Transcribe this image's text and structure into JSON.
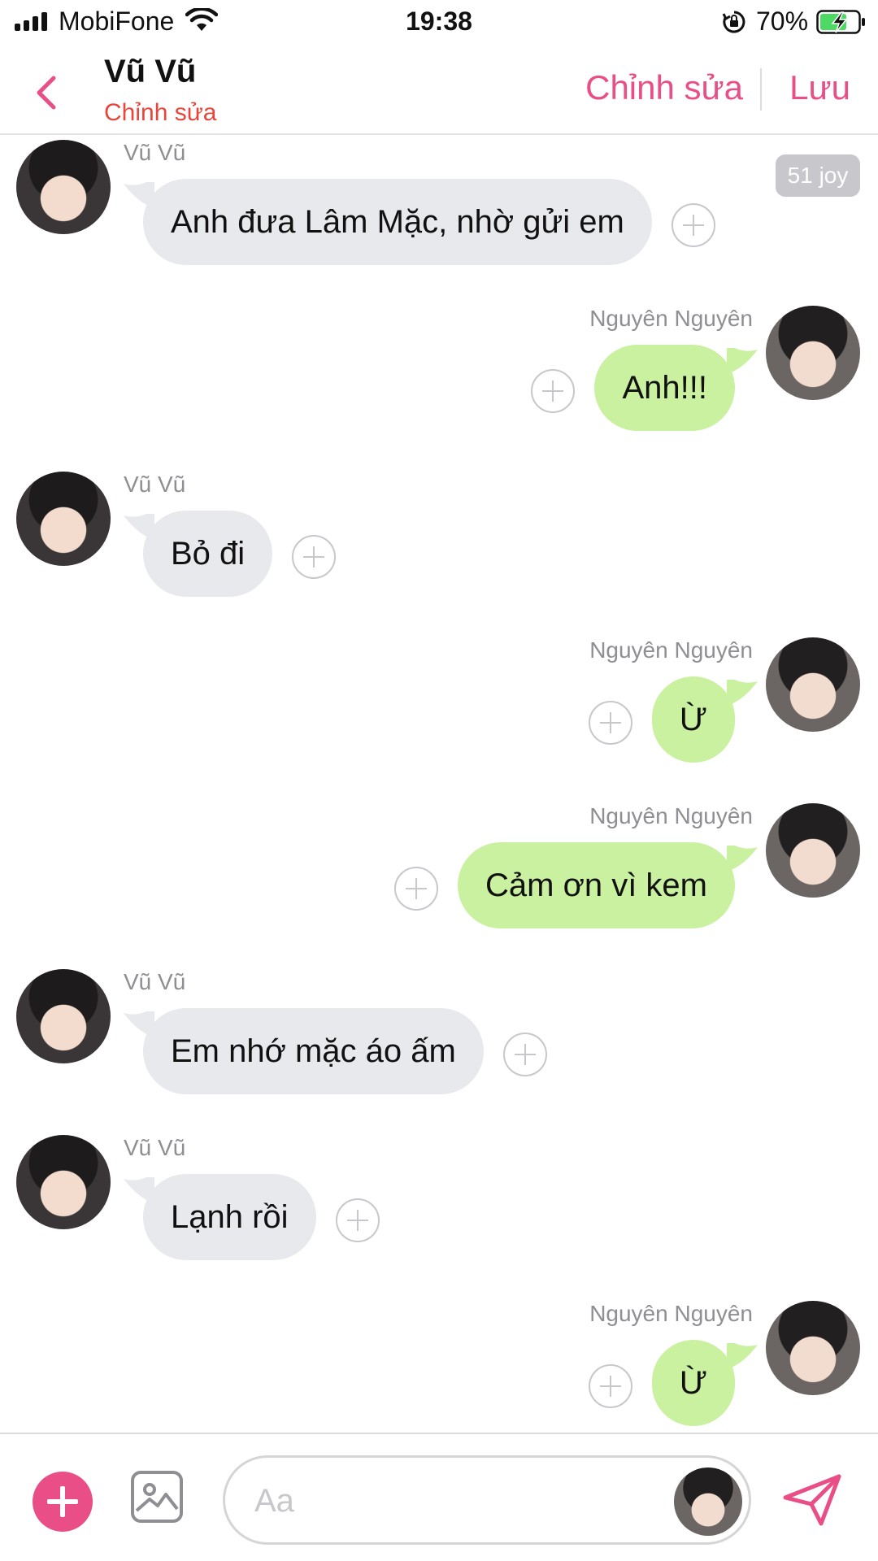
{
  "status_bar": {
    "carrier": "MobiFone",
    "time": "19:38",
    "battery": "70%",
    "battery_level": 0.7,
    "icons": [
      "signal-icon",
      "wifi-icon",
      "orientation-lock-icon",
      "battery-charging-icon"
    ]
  },
  "header": {
    "contact_name": "Vũ Vũ",
    "subtitle": "Chỉnh sửa",
    "edit_label": "Chỉnh sửa",
    "save_label": "Lưu",
    "accent_color": "#e94f86",
    "subtitle_color": "#e8453c"
  },
  "joy_badge": "51 joy",
  "messages": [
    {
      "direction": "incoming",
      "sender": "Vũ Vũ",
      "text": "Anh đưa Lâm Mặc, nhờ gửi em"
    },
    {
      "direction": "outgoing",
      "sender": "Nguyên Nguyên",
      "text": "Anh!!!"
    },
    {
      "direction": "incoming",
      "sender": "Vũ Vũ",
      "text": "Bỏ đi"
    },
    {
      "direction": "outgoing",
      "sender": "Nguyên Nguyên",
      "text": "Ừ"
    },
    {
      "direction": "outgoing",
      "sender": "Nguyên Nguyên",
      "text": "Cảm ơn vì kem"
    },
    {
      "direction": "incoming",
      "sender": "Vũ Vũ",
      "text": "Em nhớ mặc áo ấm"
    },
    {
      "direction": "incoming",
      "sender": "Vũ Vũ",
      "text": "Lạnh rồi"
    },
    {
      "direction": "outgoing",
      "sender": "Nguyên Nguyên",
      "text": "Ừ"
    }
  ],
  "colors": {
    "incoming_bubble": "#e8e9ec",
    "outgoing_bubble": "#c9f1a0",
    "sender_name": "#8e8e93"
  },
  "composer": {
    "placeholder": "Aa",
    "icons": [
      "plus-icon",
      "image-icon",
      "send-icon"
    ]
  }
}
